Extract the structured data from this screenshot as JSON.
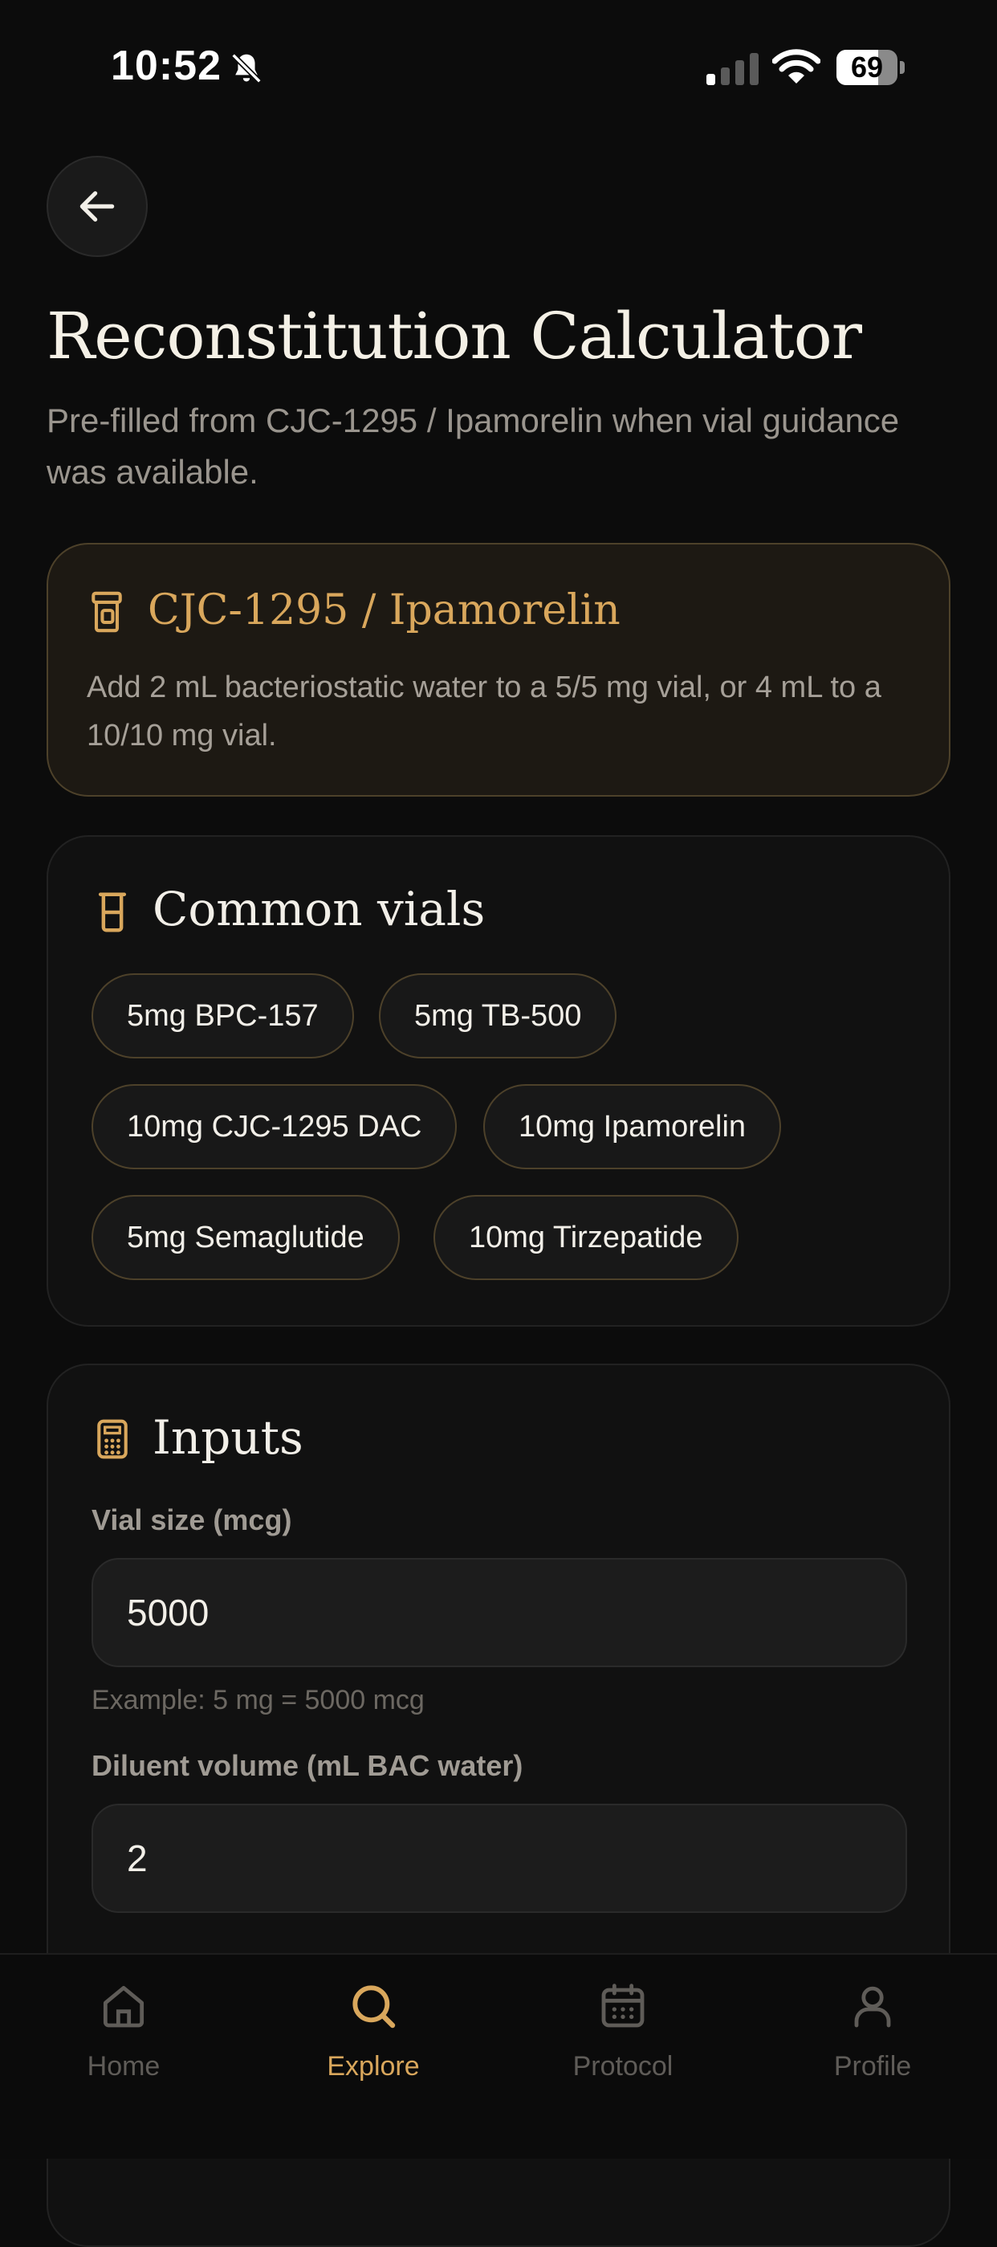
{
  "status": {
    "time": "10:52",
    "battery": "69",
    "battery_level": 0.69
  },
  "header": {
    "title": "Reconstitution Calculator",
    "subtitle": "Pre-filled from CJC-1295 / Ipamorelin when vial guidance was available."
  },
  "guidance": {
    "name": "CJC-1295 / Ipamorelin",
    "text": "Add 2 mL bacteriostatic water to a 5/5 mg vial, or 4 mL to a 10/10 mg vial."
  },
  "vials": {
    "title": "Common vials",
    "items": [
      "5mg BPC-157",
      "5mg TB-500",
      "10mg CJC-1295 DAC",
      "10mg Ipamorelin",
      "5mg Semaglutide",
      "10mg Tirzepatide"
    ]
  },
  "inputs": {
    "title": "Inputs",
    "vial_size_label": "Vial size (mcg)",
    "vial_size_value": "5000",
    "vial_size_hint": "Example: 5 mg = 5000 mcg",
    "diluent_label": "Diluent volume (mL BAC water)",
    "diluent_value": "2"
  },
  "tabs": [
    {
      "label": "Home",
      "icon": "home-icon"
    },
    {
      "label": "Explore",
      "icon": "search-icon"
    },
    {
      "label": "Protocol",
      "icon": "calendar-icon"
    },
    {
      "label": "Profile",
      "icon": "user-icon"
    }
  ],
  "colors": {
    "accent": "#d9a75c",
    "background": "#0c0c0c",
    "card": "#111111",
    "hero": "#1d1913"
  }
}
